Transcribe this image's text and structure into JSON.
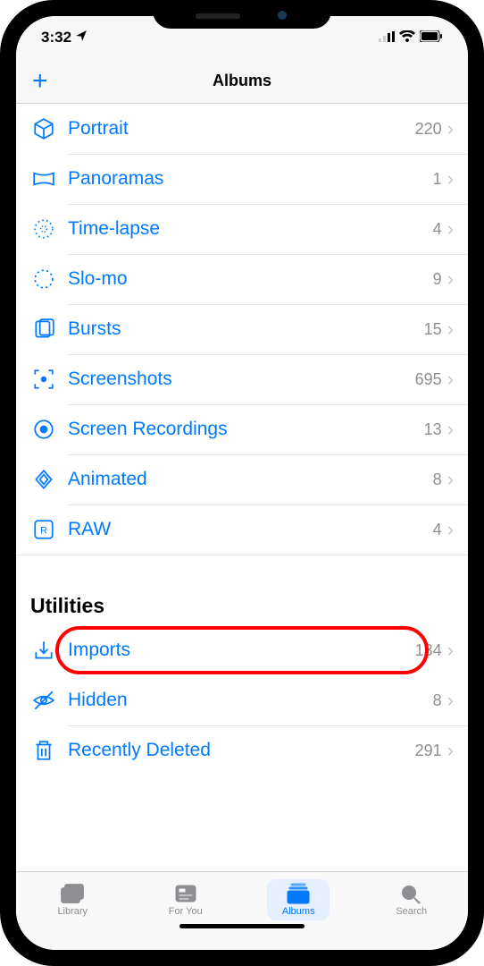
{
  "status": {
    "time": "3:32",
    "locationActive": true
  },
  "nav": {
    "title": "Albums",
    "plus_label": "+"
  },
  "mediaTypes": [
    {
      "icon": "cube",
      "label": "Portrait",
      "count": "220"
    },
    {
      "icon": "pano",
      "label": "Panoramas",
      "count": "1"
    },
    {
      "icon": "timelapse",
      "label": "Time-lapse",
      "count": "4"
    },
    {
      "icon": "slomo",
      "label": "Slo-mo",
      "count": "9"
    },
    {
      "icon": "bursts",
      "label": "Bursts",
      "count": "15"
    },
    {
      "icon": "screenshots",
      "label": "Screenshots",
      "count": "695"
    },
    {
      "icon": "screenrec",
      "label": "Screen Recordings",
      "count": "13"
    },
    {
      "icon": "animated",
      "label": "Animated",
      "count": "8"
    },
    {
      "icon": "raw",
      "label": "RAW",
      "count": "4"
    }
  ],
  "utilitiesHeader": "Utilities",
  "utilities": [
    {
      "icon": "imports",
      "label": "Imports",
      "count": "134",
      "highlighted": true
    },
    {
      "icon": "hidden",
      "label": "Hidden",
      "count": "8"
    },
    {
      "icon": "trash",
      "label": "Recently Deleted",
      "count": "291"
    }
  ],
  "tabs": [
    {
      "icon": "library",
      "label": "Library",
      "active": false
    },
    {
      "icon": "foryou",
      "label": "For You",
      "active": false
    },
    {
      "icon": "albums",
      "label": "Albums",
      "active": true
    },
    {
      "icon": "search",
      "label": "Search",
      "active": false
    }
  ]
}
